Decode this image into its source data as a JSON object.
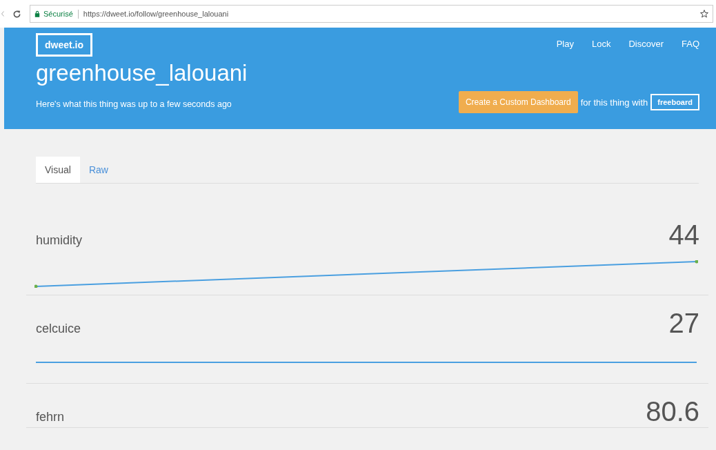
{
  "browser": {
    "secure_label": "Sécurisé",
    "url": "https://dweet.io/follow/greenhouse_lalouani"
  },
  "header": {
    "logo": "dweet.io",
    "nav": [
      "Play",
      "Lock",
      "Discover",
      "FAQ"
    ],
    "title": "greenhouse_lalouani",
    "subtitle": "Here's what this thing was up to a few seconds ago",
    "dashboard_button": "Create a Custom Dashboard",
    "dashboard_text": "for this thing with",
    "freeboard_button": "freeboard"
  },
  "tabs": [
    {
      "label": "Visual",
      "selected": true
    },
    {
      "label": "Raw",
      "selected": false
    }
  ],
  "metrics": [
    {
      "name": "humidity",
      "value": "44",
      "kind": "rising"
    },
    {
      "name": "celcuice",
      "value": "27",
      "kind": "flat"
    },
    {
      "name": "fehrn",
      "value": "80.6"
    }
  ]
}
